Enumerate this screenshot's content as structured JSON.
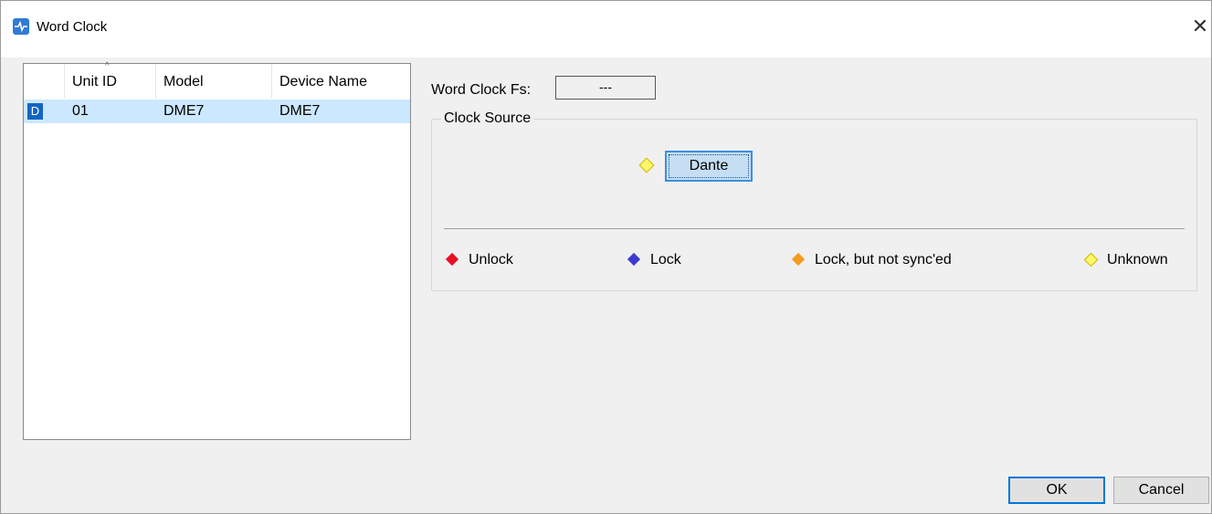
{
  "window": {
    "title": "Word Clock",
    "close_symbol": "✕"
  },
  "list": {
    "columns": [
      "Unit ID",
      "Model",
      "Device Name"
    ],
    "sort_indicator": "^",
    "rows": [
      {
        "badge": "D",
        "unit_id": "01",
        "model": "DME7",
        "device_name": "DME7"
      }
    ]
  },
  "word_clock_fs": {
    "label": "Word Clock Fs:",
    "value": "---"
  },
  "clock_source": {
    "title": "Clock Source",
    "source_label": "Dante",
    "source_status_color": "#fff66a"
  },
  "legend": {
    "unlock": {
      "label": "Unlock",
      "color": "#e81123"
    },
    "lock": {
      "label": "Lock",
      "color": "#3b3bd1"
    },
    "lock_not_synced": {
      "label": "Lock, but not sync'ed",
      "color": "#f59a1f"
    },
    "unknown": {
      "label": "Unknown",
      "color": "#fff66a"
    }
  },
  "buttons": {
    "ok": "OK",
    "cancel": "Cancel"
  }
}
